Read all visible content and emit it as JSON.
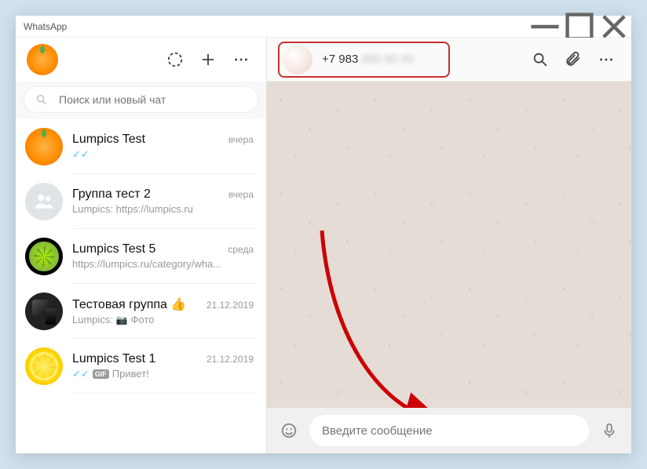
{
  "window": {
    "title": "WhatsApp"
  },
  "sidebar": {
    "search_placeholder": "Поиск или новый чат"
  },
  "chats": [
    {
      "name": "Lumpics Test",
      "time": "вчера",
      "sub": "",
      "ticks": true
    },
    {
      "name": "Группа тест 2",
      "time": "вчера",
      "sub": "Lumpics: https://lumpics.ru"
    },
    {
      "name": "Lumpics Test 5",
      "time": "среда",
      "sub": "https://lumpics.ru/category/wha..."
    },
    {
      "name": "Тестовая группа 👍",
      "time": "21.12.2019",
      "sub_prefix": "Lumpics:",
      "sub": "Фото",
      "photo": true
    },
    {
      "name": "Lumpics Test 1",
      "time": "21.12.2019",
      "sub": "Привет!",
      "ticks": true,
      "gif": true
    }
  ],
  "conversation": {
    "contact_number_visible": "+7 983",
    "contact_number_hidden": "000 00 00"
  },
  "composer": {
    "placeholder": "Введите сообщение"
  }
}
